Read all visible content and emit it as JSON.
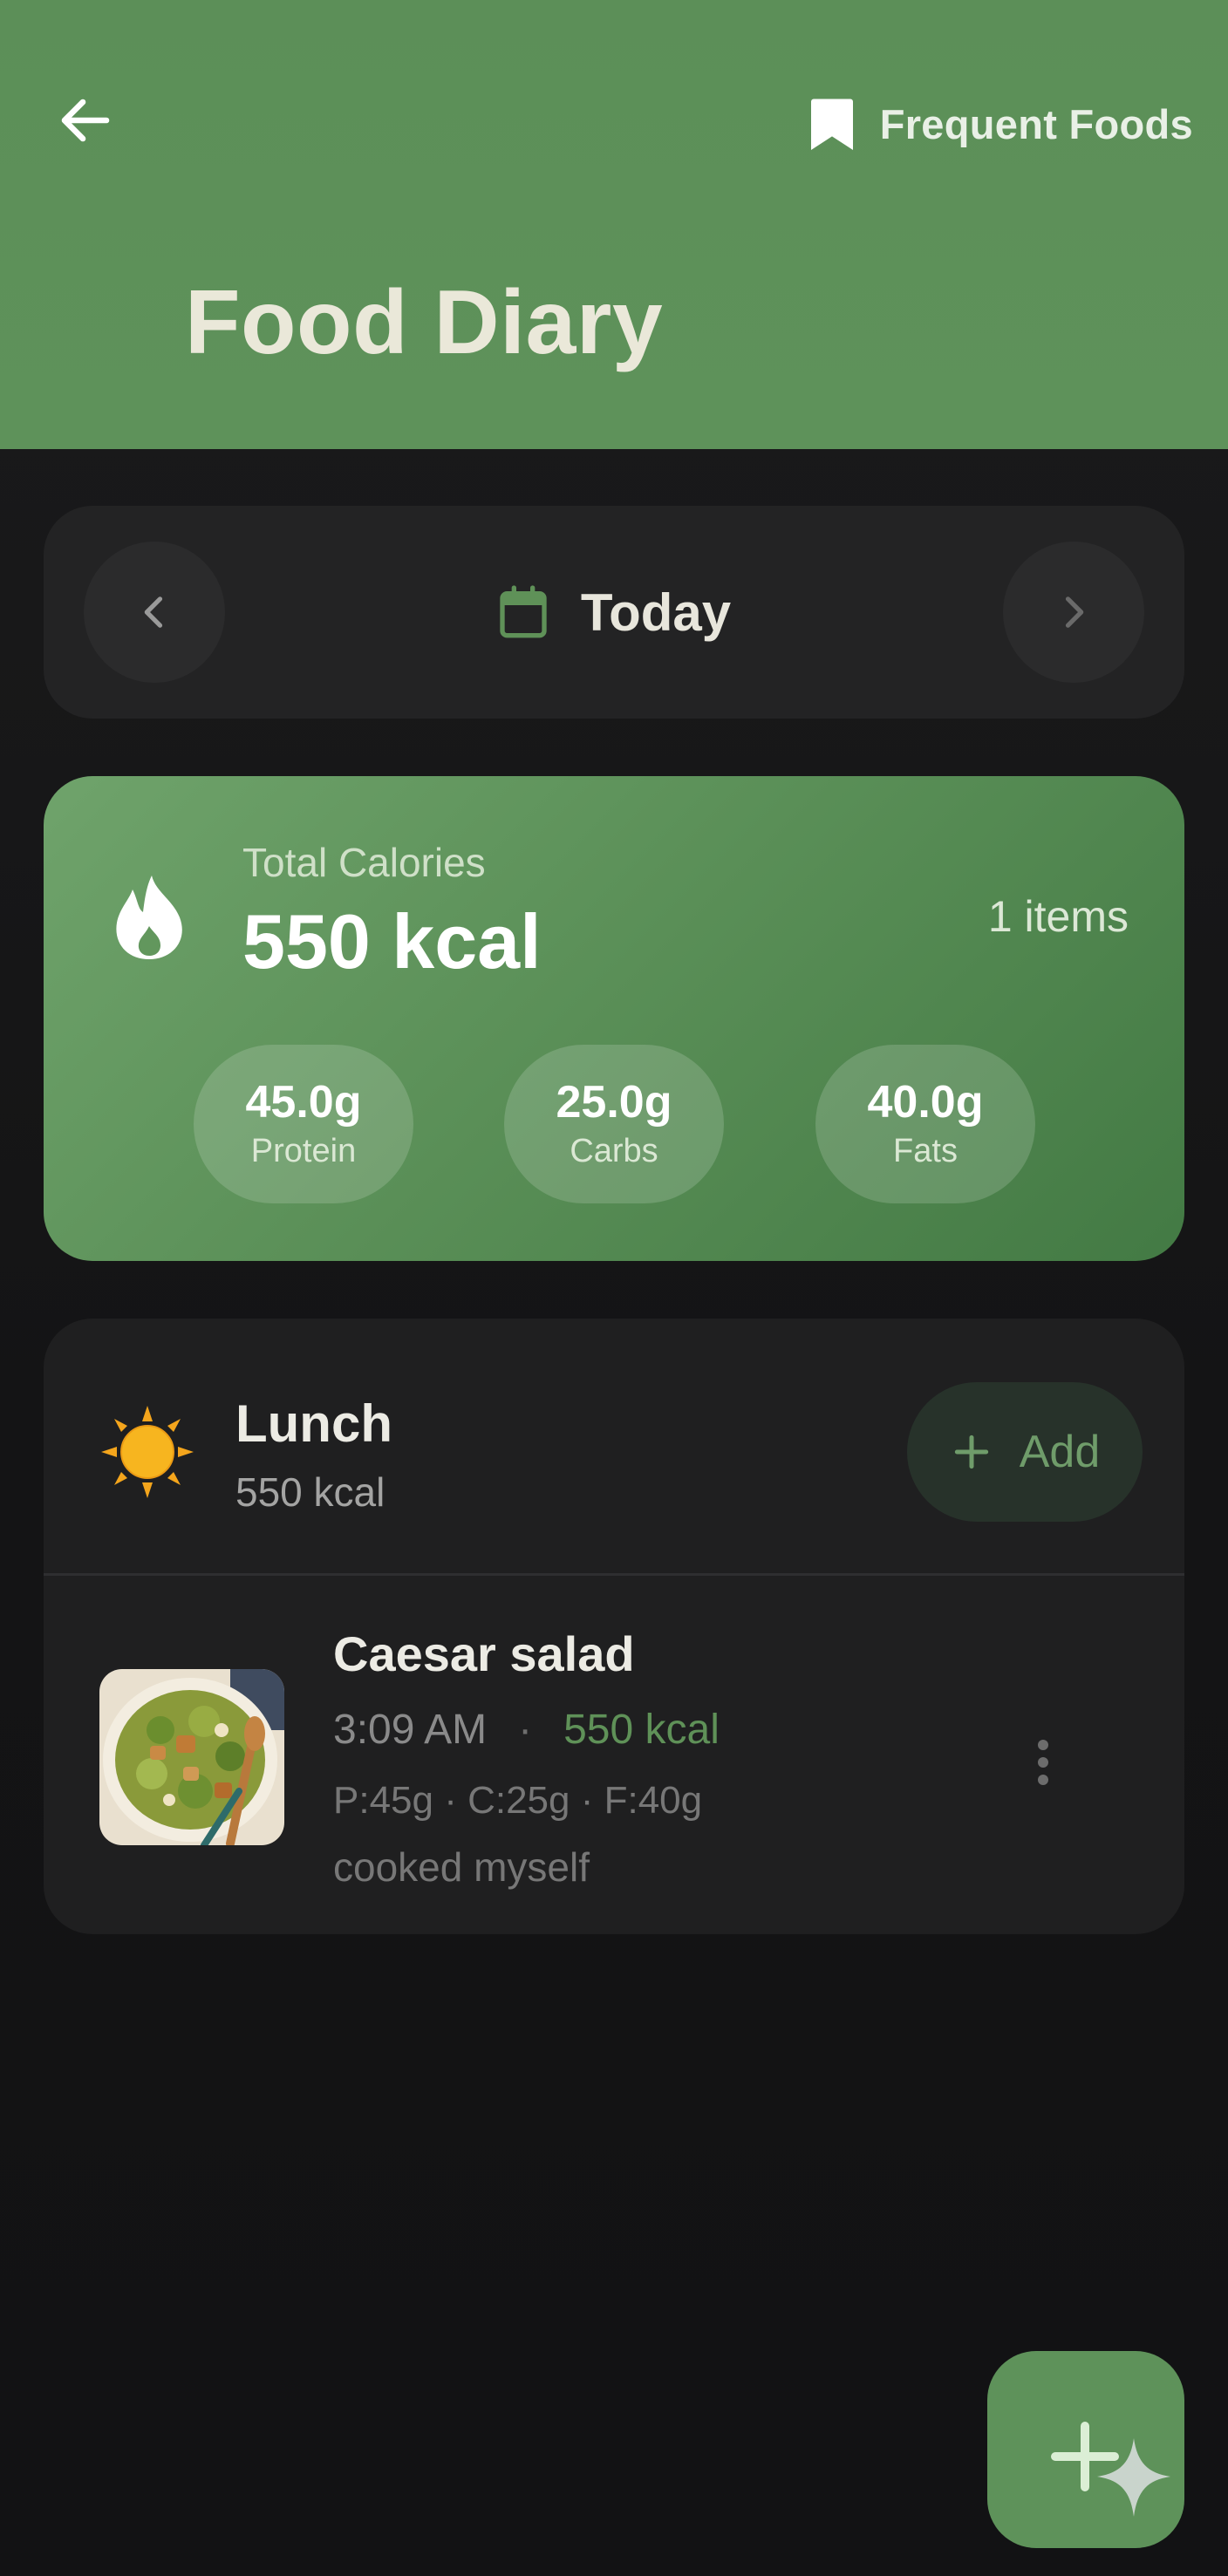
{
  "header": {
    "title": "Food Diary",
    "frequent_foods_label": "Frequent Foods",
    "back_icon": "arrow-left-icon",
    "bookmark_icon": "bookmark-icon"
  },
  "date_nav": {
    "label": "Today",
    "calendar_icon": "calendar-icon"
  },
  "summary": {
    "label": "Total Calories",
    "value": "550 kcal",
    "items": "1 items",
    "macros": [
      {
        "value": "45.0g",
        "label": "Protein"
      },
      {
        "value": "25.0g",
        "label": "Carbs"
      },
      {
        "value": "40.0g",
        "label": "Fats"
      }
    ]
  },
  "meal": {
    "title": "Lunch",
    "kcal": "550 kcal",
    "add_label": "Add",
    "entry": {
      "name": "Caesar salad",
      "time": "3:09 AM",
      "separator": "·",
      "kcal": "550 kcal",
      "macros": "P:45g · C:25g · F:40g",
      "note": "cooked myself"
    }
  },
  "colors": {
    "accent": "#5e925a",
    "kcal_green": "#5f9158",
    "background": "#141416"
  }
}
